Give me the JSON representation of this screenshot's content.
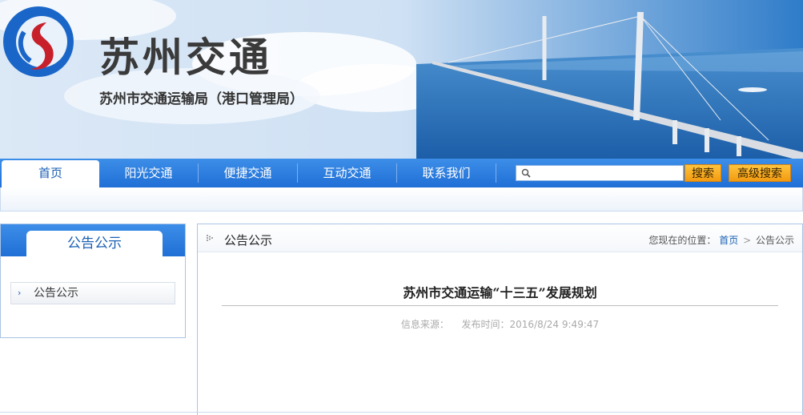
{
  "header": {
    "title": "苏州交通",
    "subtitle": "苏州市交通运输局（港口管理局）",
    "logo_icon": "swirl-logo-icon"
  },
  "nav": {
    "items": [
      {
        "label": "首页",
        "active": true
      },
      {
        "label": "阳光交通",
        "active": false
      },
      {
        "label": "便捷交通",
        "active": false
      },
      {
        "label": "互动交通",
        "active": false
      },
      {
        "label": "联系我们",
        "active": false
      }
    ]
  },
  "search": {
    "value": "",
    "placeholder": "",
    "search_label": "搜索",
    "advanced_label": "高级搜索"
  },
  "sidebar": {
    "heading": "公告公示",
    "items": [
      {
        "label": "公告公示"
      }
    ]
  },
  "main": {
    "heading": "公告公示",
    "breadcrumb": {
      "prefix": "您现在的位置：",
      "home": "首页",
      "separator": ">",
      "current": "公告公示"
    },
    "article": {
      "title": "苏州市交通运输“十三五”发展规划",
      "source_label": "信息来源：",
      "time_label": "发布时间：2016/8/24 9:49:47"
    }
  },
  "colors": {
    "nav_blue": "#1f6fd6",
    "button_orange": "#f29a10",
    "link_blue": "#1a5fb4"
  }
}
